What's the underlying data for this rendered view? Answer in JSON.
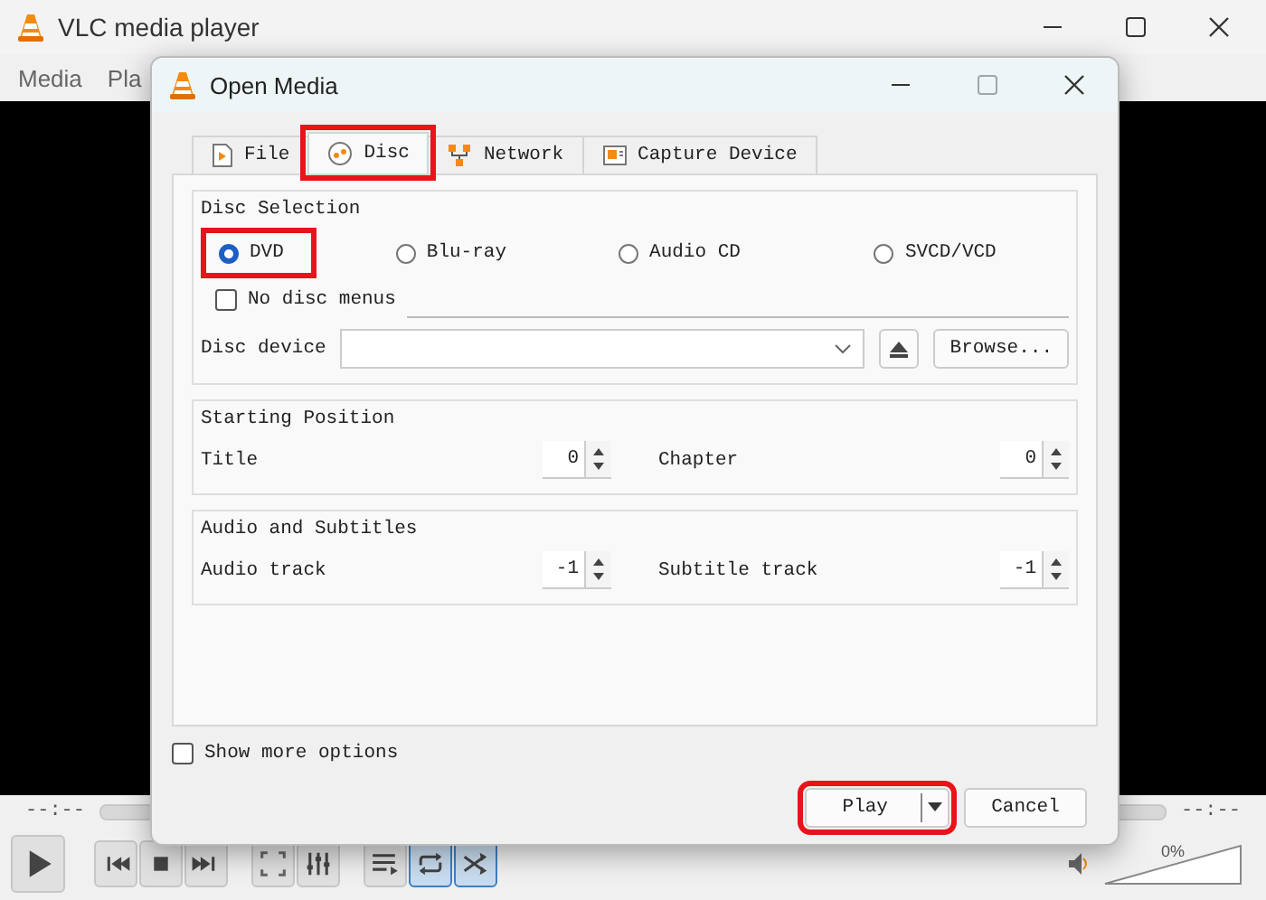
{
  "window": {
    "title": "VLC media player"
  },
  "menu": [
    {
      "label": "Media"
    },
    {
      "label": "Pla"
    }
  ],
  "dialog": {
    "title": "Open Media",
    "tabs": [
      {
        "label": "File",
        "kind": "file",
        "selected": false,
        "highlighted": false
      },
      {
        "label": "Disc",
        "kind": "disc",
        "selected": true,
        "highlighted": true
      },
      {
        "label": "Network",
        "kind": "network",
        "selected": false,
        "highlighted": false
      },
      {
        "label": "Capture Device",
        "kind": "capture",
        "selected": false,
        "highlighted": false
      }
    ],
    "disc_selection": {
      "title": "Disc Selection",
      "options": [
        {
          "label": "DVD",
          "selected": true,
          "highlighted": true
        },
        {
          "label": "Blu-ray",
          "selected": false,
          "highlighted": false
        },
        {
          "label": "Audio CD",
          "selected": false,
          "highlighted": false
        },
        {
          "label": "SVCD/VCD",
          "selected": false,
          "highlighted": false
        }
      ],
      "no_disc_menus": {
        "label": "No disc menus",
        "checked": false
      },
      "device_label": "Disc device",
      "browse": "Browse..."
    },
    "starting_position": {
      "title": "Starting Position",
      "fields": [
        {
          "label": "Title",
          "value": "0"
        },
        {
          "label": "Chapter",
          "value": "0"
        }
      ]
    },
    "audio_subtitles": {
      "title": "Audio and Subtitles",
      "fields": [
        {
          "label": "Audio track",
          "value": "-1"
        },
        {
          "label": "Subtitle track",
          "value": "-1"
        }
      ]
    },
    "show_more": {
      "label": "Show more options",
      "checked": false
    },
    "play": {
      "label": "Play",
      "highlighted": true
    },
    "cancel": {
      "label": "Cancel"
    }
  },
  "player": {
    "elapsed": "--:--",
    "total": "--:--",
    "volume": "0%",
    "volume_slider": {
      "level": 0
    },
    "controls": [
      {
        "kind": "play",
        "on": false
      },
      {
        "kind": "previous",
        "on": false
      },
      {
        "kind": "stop",
        "on": false
      },
      {
        "kind": "next",
        "on": false
      },
      {
        "kind": "fullscreen",
        "on": false
      },
      {
        "kind": "equalizer",
        "on": false
      },
      {
        "kind": "playlist",
        "on": false
      },
      {
        "kind": "loop",
        "on": true
      },
      {
        "kind": "shuffle",
        "on": true
      }
    ]
  }
}
